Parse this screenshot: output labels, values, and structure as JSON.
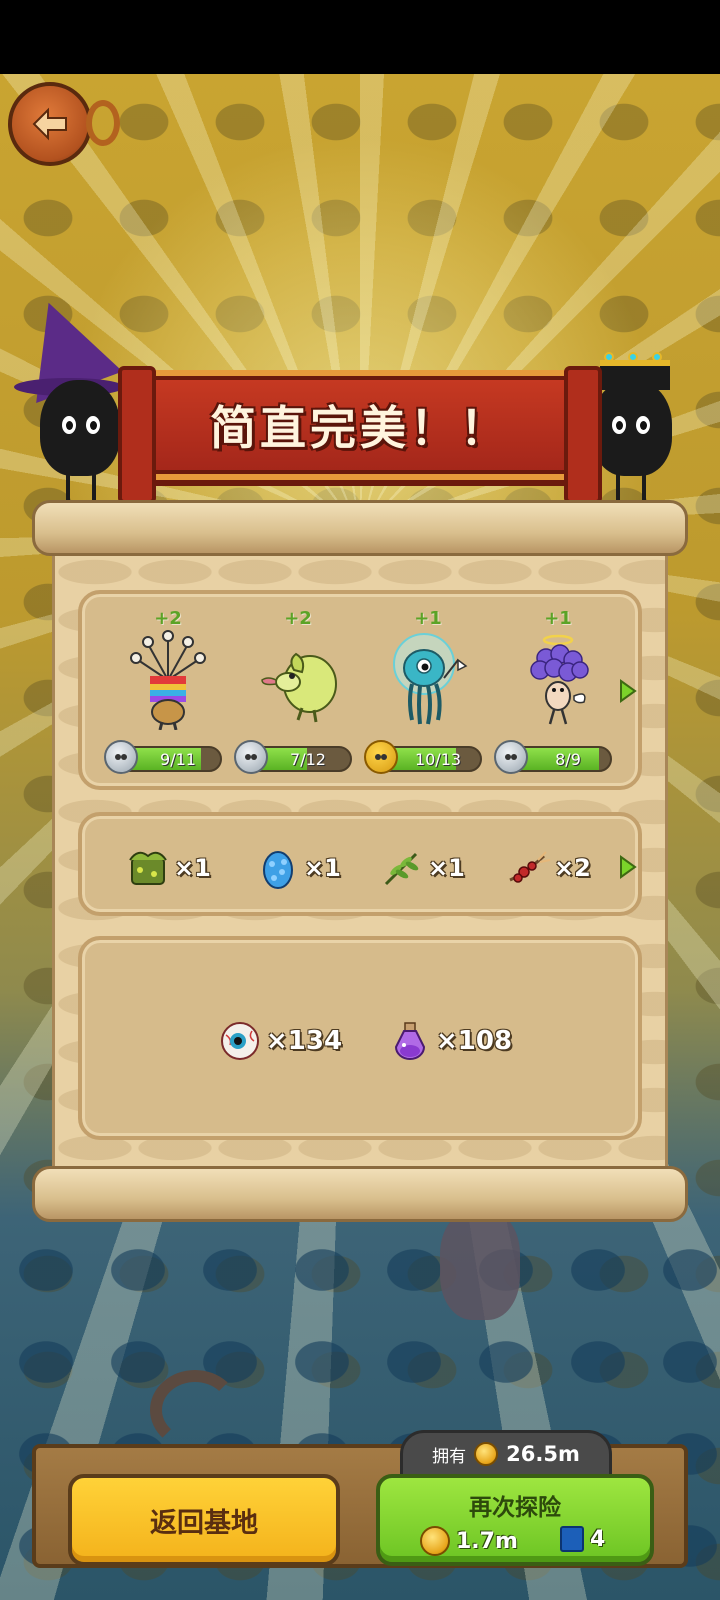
{
  "banner": {
    "title": "简直完美！！"
  },
  "monsters": [
    {
      "name": "mushroom-tree",
      "gain": "+2",
      "progress": "9/11",
      "fraction": 0.818,
      "badge": "silver"
    },
    {
      "name": "cabbage-creature",
      "gain": "+2",
      "progress": "7/12",
      "fraction": 0.583,
      "badge": "silver"
    },
    {
      "name": "jellyfish-astronaut",
      "gain": "+1",
      "progress": "10/13",
      "fraction": 0.769,
      "badge": "gold"
    },
    {
      "name": "grape-angel",
      "gain": "+1",
      "progress": "8/9",
      "fraction": 0.889,
      "badge": "silver"
    }
  ],
  "items": [
    {
      "icon": "moss-chest-icon",
      "qty": "×1"
    },
    {
      "icon": "blue-egg-icon",
      "qty": "×1"
    },
    {
      "icon": "herb-icon",
      "qty": "×1"
    },
    {
      "icon": "berry-branch-icon",
      "qty": "×2"
    }
  ],
  "resources": [
    {
      "icon": "eyeball-icon",
      "qty": "×134"
    },
    {
      "icon": "purple-potion-icon",
      "qty": "×108"
    }
  ],
  "owned": {
    "label": "拥有",
    "value": "26.5m"
  },
  "buttons": {
    "return": "返回基地",
    "again": "再次探险",
    "again_cost": "1.7m",
    "again_tickets": "4"
  },
  "colors": {
    "accent_green": "#6cc423",
    "accent_yellow": "#f4b21b",
    "banner_red": "#a3261a"
  }
}
